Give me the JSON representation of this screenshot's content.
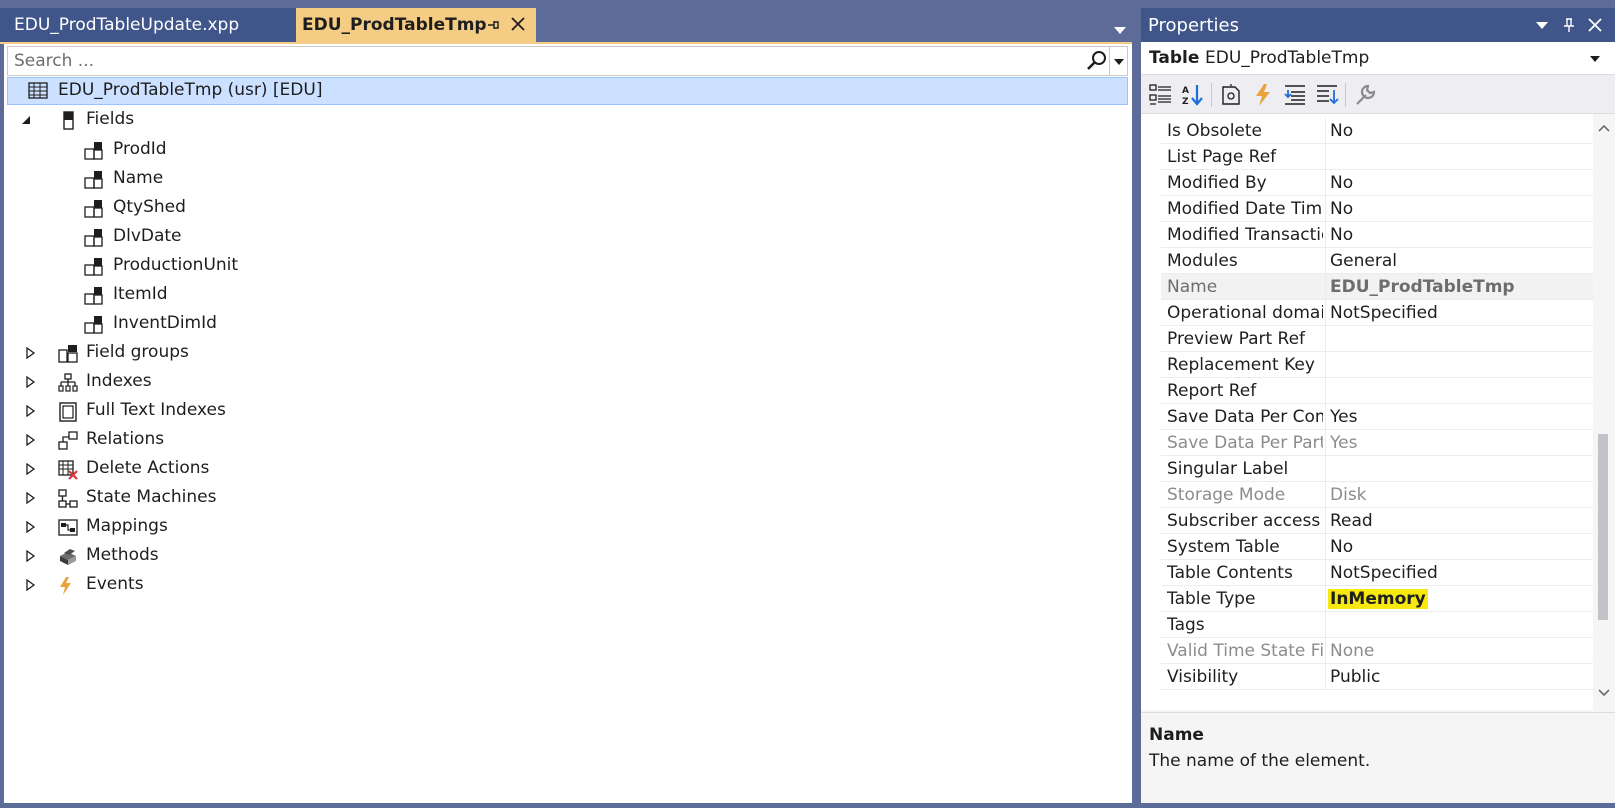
{
  "tabs": {
    "inactive_label": "EDU_ProdTableUpdate.xpp",
    "active_label": "EDU_ProdTableTmp"
  },
  "search": {
    "placeholder": "Search ..."
  },
  "tree": {
    "root": "EDU_ProdTableTmp (usr) [EDU]",
    "fields_label": "Fields",
    "fields": [
      "ProdId",
      "Name",
      "QtyShed",
      "DlvDate",
      "ProductionUnit",
      "ItemId",
      "InventDimId"
    ],
    "nodes": [
      "Field groups",
      "Indexes",
      "Full Text Indexes",
      "Relations",
      "Delete Actions",
      "State Machines",
      "Mappings",
      "Methods",
      "Events"
    ]
  },
  "properties": {
    "title": "Properties",
    "object_kind": "Table",
    "object_name": "EDU_ProdTableTmp",
    "rows": [
      {
        "name": "Is Obsolete",
        "value": "No"
      },
      {
        "name": "List Page Ref",
        "value": ""
      },
      {
        "name": "Modified By",
        "value": "No"
      },
      {
        "name": "Modified Date Time",
        "value": "No"
      },
      {
        "name": "Modified Transaction",
        "value": "No"
      },
      {
        "name": "Modules",
        "value": "General"
      },
      {
        "name": "Name",
        "value": "EDU_ProdTableTmp"
      },
      {
        "name": "Operational domain",
        "value": "NotSpecified"
      },
      {
        "name": "Preview Part Ref",
        "value": ""
      },
      {
        "name": "Replacement Key",
        "value": ""
      },
      {
        "name": "Report Ref",
        "value": ""
      },
      {
        "name": "Save Data Per Company",
        "value": "Yes"
      },
      {
        "name": "Save Data Per Partition",
        "value": "Yes"
      },
      {
        "name": "Singular Label",
        "value": ""
      },
      {
        "name": "Storage Mode",
        "value": "Disk"
      },
      {
        "name": "Subscriber access level",
        "value": "Read"
      },
      {
        "name": "System Table",
        "value": "No"
      },
      {
        "name": "Table Contents",
        "value": "NotSpecified"
      },
      {
        "name": "Table Type",
        "value": "InMemory"
      },
      {
        "name": "Tags",
        "value": ""
      },
      {
        "name": "Valid Time State Field Type",
        "value": "None"
      },
      {
        "name": "Visibility",
        "value": "Public"
      }
    ],
    "description_title": "Name",
    "description_text": "The name of the element."
  },
  "colors": {
    "chrome": "#5d6b99",
    "title_bar": "#40568a",
    "active_tab": "#f5cc84",
    "selection": "#cce0ff",
    "highlight": "#f7e80d",
    "event_icon": "#e8a33d"
  }
}
